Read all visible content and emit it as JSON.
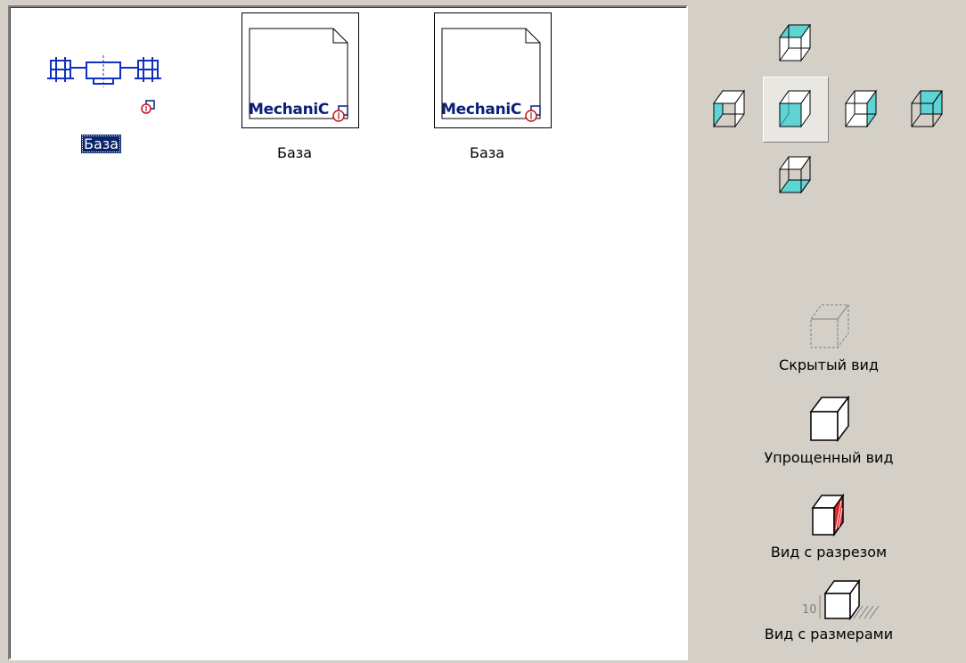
{
  "items": [
    {
      "caption": "База",
      "selected": true
    },
    {
      "caption": "База",
      "selected": false,
      "thumb_text": "MechaniC"
    },
    {
      "caption": "База",
      "selected": false,
      "thumb_text": "MechaniC"
    }
  ],
  "views": [
    {
      "name": "top-view",
      "pressed": false
    },
    {
      "name": "left-view",
      "pressed": false
    },
    {
      "name": "front-view",
      "pressed": true
    },
    {
      "name": "right-view",
      "pressed": false
    },
    {
      "name": "back-view",
      "pressed": false
    },
    {
      "name": "bottom-view",
      "pressed": false
    }
  ],
  "modes": {
    "hidden": "Скрытый вид",
    "simplified": "Упрощенный вид",
    "section": "Вид с разрезом",
    "dimensions": "Вид с размерами"
  },
  "dimension_icon_text": "10",
  "colors": {
    "accent": "#5fd4d4",
    "selection": "#0a246a",
    "thumb_text": "#0a1f7a",
    "section_red": "#e8202a"
  }
}
